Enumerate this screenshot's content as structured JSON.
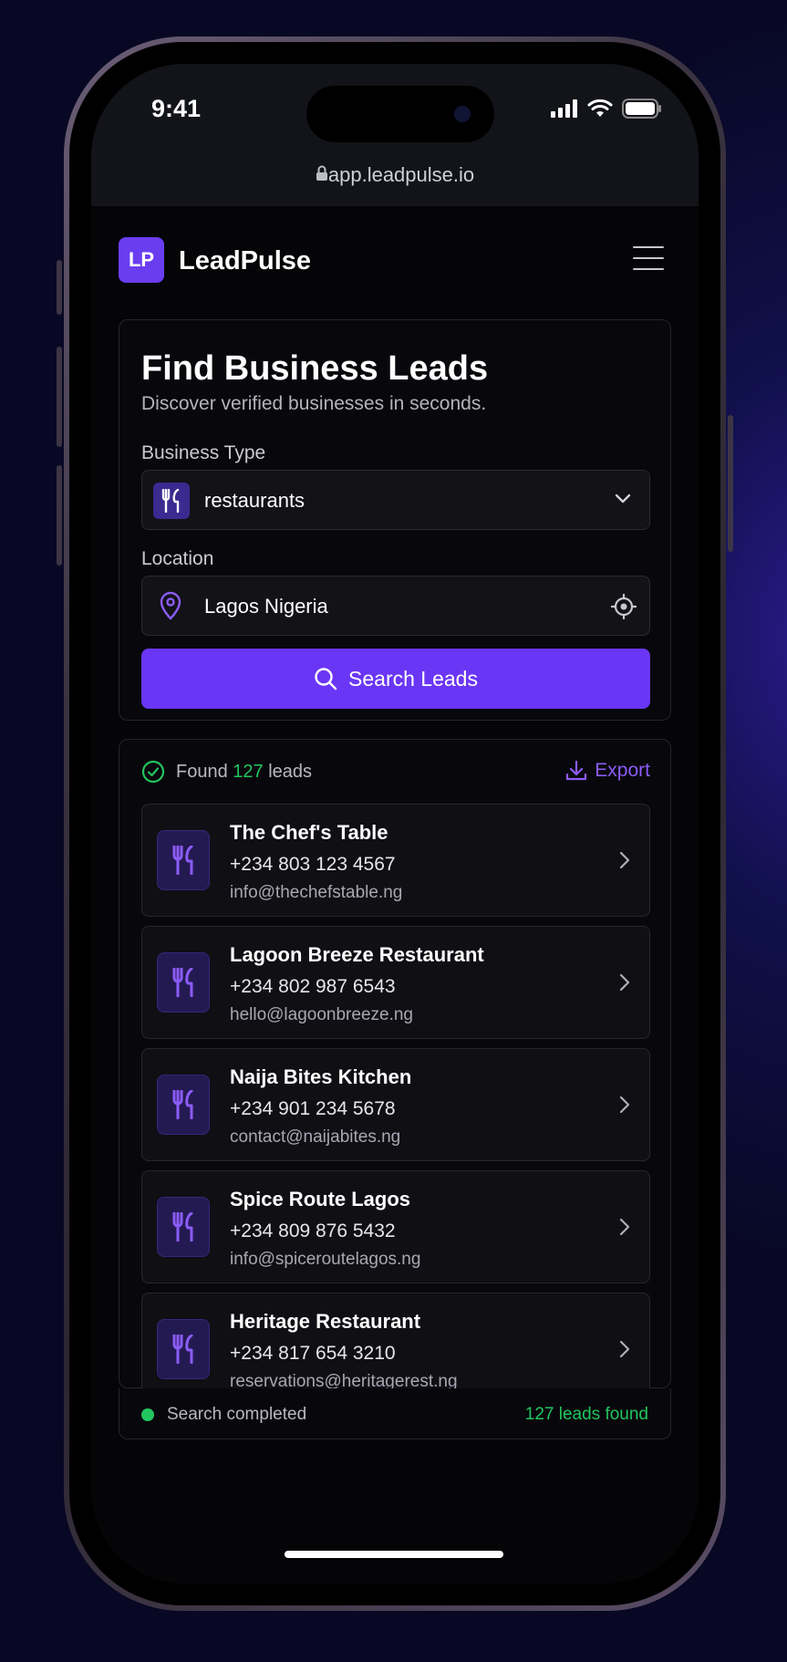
{
  "status_bar": {
    "time": "9:41"
  },
  "browser": {
    "url": "app.leadpulse.io"
  },
  "header": {
    "logo": "LP",
    "brand": "LeadPulse"
  },
  "search": {
    "title": "Find Business Leads",
    "subtitle": "Discover verified businesses in seconds.",
    "business_type_label": "Business Type",
    "business_type_value": "restaurants",
    "location_label": "Location",
    "location_value": "Lagos Nigeria",
    "button_label": "Search Leads"
  },
  "results": {
    "found_prefix": "Found",
    "found_count": "127",
    "found_suffix": "leads",
    "export_label": "Export",
    "leads": [
      {
        "name": "The Chef's Table",
        "phone": "+234 803 123 4567",
        "email": "info@thechefstable.ng"
      },
      {
        "name": "Lagoon Breeze Restaurant",
        "phone": "+234 802 987 6543",
        "email": "hello@lagoonbreeze.ng"
      },
      {
        "name": "Naija Bites Kitchen",
        "phone": "+234 901 234 5678",
        "email": "contact@naijabites.ng"
      },
      {
        "name": "Spice Route Lagos",
        "phone": "+234 809 876 5432",
        "email": "info@spiceroutelagos.ng"
      },
      {
        "name": "Heritage Restaurant",
        "phone": "+234 817 654 3210",
        "email": "reservations@heritagerest.ng"
      }
    ],
    "footer_status": "Search completed",
    "footer_count": "127",
    "footer_count_suffix": "leads found"
  },
  "colors": {
    "accent": "#6a36f5",
    "success": "#22c55e",
    "export": "#8b5cf6"
  },
  "icons": [
    "lock-icon",
    "signal-icon",
    "wifi-icon",
    "battery-icon",
    "menu-icon",
    "utensils-icon",
    "chevron-down-icon",
    "map-pin-icon",
    "locate-icon",
    "search-icon",
    "check-circle-icon",
    "download-icon",
    "chevron-right-icon"
  ]
}
